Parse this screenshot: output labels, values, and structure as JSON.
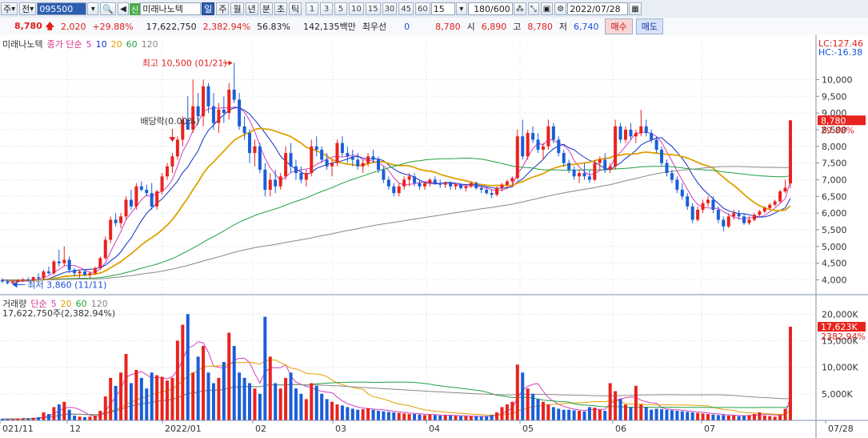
{
  "toolbar": {
    "market_label": "주",
    "prev_label": "전",
    "code": "095500",
    "badge": "신",
    "name": "미래나노텍",
    "periods": [
      "일",
      "주",
      "월",
      "년",
      "분",
      "초",
      "틱"
    ],
    "active_period": "일",
    "intervals": [
      "1",
      "3",
      "5",
      "10",
      "15",
      "30",
      "45",
      "60"
    ],
    "interval_value": "15",
    "count": "180/600",
    "date": "2022/07/28",
    "icons": [
      "search-icon",
      "zoom-icon",
      "save-icon",
      "gear-icon",
      "calendar-icon"
    ]
  },
  "quote": {
    "price": "8,780",
    "change": "2,020",
    "change_pct": "+29.88%",
    "volume": "17,622,750",
    "volume_pct": "2,382.94%",
    "rate": "56.83%",
    "amount": "142,135백만",
    "pref_label": "최우선",
    "pref_value": "0",
    "close": "8,780",
    "open_label": "시",
    "open": "6,890",
    "high_label": "고",
    "high": "8,780",
    "low_label": "저",
    "low": "6,740",
    "buy_label": "매수",
    "sell_label": "매도"
  },
  "chart_data": {
    "type": "candlestick",
    "title": "미래나노텍",
    "legend": "종가 단순 5 10 20 60 120",
    "legend_parts": [
      {
        "text": "미래나노텍",
        "color": "#333333"
      },
      {
        "text": "종가 단순",
        "color": "#d63384"
      },
      {
        "text": "5",
        "color": "#d040c0"
      },
      {
        "text": "10",
        "color": "#1030c0"
      },
      {
        "text": "20",
        "color": "#e0a000"
      },
      {
        "text": "60",
        "color": "#20a040"
      },
      {
        "text": "120",
        "color": "#888888"
      }
    ],
    "lc_label": "LC:127.46",
    "hc_label": "HC:-16.38",
    "y_ticks": [
      10000,
      9500,
      9000,
      8500,
      8000,
      7500,
      7000,
      6500,
      6000,
      5500,
      5000,
      4500,
      4000
    ],
    "y_tick_labels": [
      "10,000",
      "9,500",
      "9,000",
      "8,500",
      "8,000",
      "7,500",
      "7,000",
      "6,500",
      "6,000",
      "5,500",
      "5,000",
      "4,500",
      "4,000"
    ],
    "current_price_label": "8,780",
    "current_pct_label": "29.88%",
    "annotations": {
      "high": "최고 10,500 (01/21)",
      "low": "최저 3,860 (11/11)",
      "dividend": "배당락(0.00%)"
    },
    "x_labels": [
      "021/11",
      "12",
      "2022/01",
      "02",
      "03",
      "04",
      "05",
      "06",
      "07",
      "07/28"
    ],
    "candles": [
      [
        4000,
        4050,
        3900,
        3950
      ],
      [
        3950,
        4000,
        3860,
        3900
      ],
      [
        3900,
        3980,
        3870,
        3940
      ],
      [
        3940,
        4020,
        3900,
        3980
      ],
      [
        3980,
        4060,
        3940,
        4010
      ],
      [
        4010,
        4080,
        3960,
        3990
      ],
      [
        3990,
        4100,
        3950,
        4080
      ],
      [
        4080,
        4200,
        4000,
        4050
      ],
      [
        4050,
        4300,
        4000,
        4250
      ],
      [
        4250,
        4400,
        4150,
        4200
      ],
      [
        4200,
        4600,
        4150,
        4550
      ],
      [
        4550,
        4900,
        4400,
        4500
      ],
      [
        4500,
        5000,
        4400,
        4600
      ],
      [
        4600,
        4700,
        4200,
        4300
      ],
      [
        4300,
        4350,
        4100,
        4200
      ],
      [
        4200,
        4300,
        4050,
        4250
      ],
      [
        4250,
        4300,
        4100,
        4150
      ],
      [
        4150,
        4250,
        4050,
        4200
      ],
      [
        4200,
        4400,
        4150,
        4350
      ],
      [
        4350,
        4700,
        4300,
        4650
      ],
      [
        4650,
        5300,
        4600,
        5200
      ],
      [
        5200,
        5900,
        5100,
        5800
      ],
      [
        5800,
        6000,
        5600,
        5700
      ],
      [
        5700,
        6000,
        5550,
        5900
      ],
      [
        5900,
        6500,
        5800,
        6400
      ],
      [
        6400,
        6700,
        6100,
        6200
      ],
      [
        6200,
        6900,
        6100,
        6800
      ],
      [
        6800,
        6950,
        6650,
        6700
      ],
      [
        6700,
        6850,
        6500,
        6600
      ],
      [
        6600,
        6900,
        6100,
        6200
      ],
      [
        6200,
        6700,
        6100,
        6650
      ],
      [
        6650,
        7200,
        6550,
        7100
      ],
      [
        7100,
        7500,
        7000,
        7400
      ],
      [
        7400,
        7800,
        7200,
        7700
      ],
      [
        7700,
        8300,
        7600,
        8200
      ],
      [
        8200,
        8900,
        8000,
        8800
      ],
      [
        8800,
        9500,
        8600,
        8500
      ],
      [
        8500,
        10000,
        8400,
        9200
      ],
      [
        9200,
        9600,
        8700,
        8900
      ],
      [
        8900,
        10000,
        8600,
        9800
      ],
      [
        9800,
        9900,
        9000,
        9200
      ],
      [
        9200,
        9600,
        8500,
        8700
      ],
      [
        8700,
        9300,
        8400,
        9100
      ],
      [
        9100,
        9500,
        8700,
        9000
      ],
      [
        9000,
        9900,
        8800,
        9700
      ],
      [
        9700,
        10500,
        9300,
        9400
      ],
      [
        9400,
        9600,
        8500,
        8600
      ],
      [
        8600,
        8900,
        8200,
        8400
      ],
      [
        8400,
        8500,
        7500,
        7800
      ],
      [
        7800,
        8200,
        7400,
        8000
      ],
      [
        8000,
        8100,
        7200,
        7300
      ],
      [
        7300,
        7500,
        6500,
        6700
      ],
      [
        6700,
        7200,
        6500,
        7000
      ],
      [
        7000,
        7300,
        6600,
        6800
      ],
      [
        6800,
        7200,
        6700,
        7100
      ],
      [
        7100,
        8000,
        7000,
        7800
      ],
      [
        7800,
        8100,
        7200,
        7400
      ],
      [
        7400,
        7600,
        7000,
        7200
      ],
      [
        7200,
        7400,
        6900,
        7000
      ],
      [
        7000,
        7300,
        6800,
        7200
      ],
      [
        7200,
        8200,
        7100,
        8000
      ],
      [
        8000,
        8300,
        7700,
        7900
      ],
      [
        7900,
        8000,
        7500,
        7600
      ],
      [
        7600,
        7800,
        7300,
        7400
      ],
      [
        7400,
        7600,
        7100,
        7500
      ],
      [
        7500,
        8200,
        7400,
        8100
      ],
      [
        8100,
        8300,
        7700,
        7800
      ],
      [
        7800,
        8000,
        7500,
        7700
      ],
      [
        7700,
        7900,
        7400,
        7600
      ],
      [
        7600,
        7800,
        7300,
        7400
      ],
      [
        7400,
        7600,
        7200,
        7500
      ],
      [
        7500,
        7800,
        7400,
        7700
      ],
      [
        7700,
        7900,
        7500,
        7600
      ],
      [
        7600,
        7700,
        7200,
        7300
      ],
      [
        7300,
        7400,
        6900,
        7000
      ],
      [
        7000,
        7100,
        6700,
        6800
      ],
      [
        6800,
        6900,
        6500,
        6600
      ],
      [
        6600,
        6900,
        6500,
        6800
      ],
      [
        6800,
        7100,
        6700,
        7000
      ],
      [
        7000,
        7200,
        6800,
        7100
      ],
      [
        7100,
        7200,
        6800,
        6900
      ],
      [
        6900,
        7000,
        6700,
        6800
      ],
      [
        6800,
        6950,
        6700,
        6900
      ],
      [
        6900,
        7050,
        6800,
        7000
      ],
      [
        7000,
        7100,
        6850,
        6900
      ],
      [
        6900,
        7000,
        6750,
        6850
      ],
      [
        6850,
        6950,
        6750,
        6900
      ],
      [
        6900,
        6950,
        6700,
        6800
      ],
      [
        6800,
        6900,
        6700,
        6850
      ],
      [
        6850,
        6900,
        6700,
        6750
      ],
      [
        6750,
        6850,
        6650,
        6800
      ],
      [
        6800,
        6950,
        6750,
        6900
      ],
      [
        6900,
        6950,
        6700,
        6750
      ],
      [
        6750,
        6800,
        6600,
        6700
      ],
      [
        6700,
        6800,
        6550,
        6600
      ],
      [
        6600,
        6700,
        6450,
        6550
      ],
      [
        6550,
        6800,
        6500,
        6750
      ],
      [
        6750,
        6900,
        6650,
        6850
      ],
      [
        6850,
        7000,
        6750,
        6950
      ],
      [
        6950,
        7100,
        6800,
        7050
      ],
      [
        7050,
        8500,
        7000,
        8300
      ],
      [
        8300,
        8800,
        7600,
        7700
      ],
      [
        7700,
        8500,
        7600,
        8400
      ],
      [
        8400,
        8600,
        8100,
        8200
      ],
      [
        8200,
        8400,
        7800,
        7900
      ],
      [
        7900,
        8100,
        7600,
        8000
      ],
      [
        8000,
        8800,
        7900,
        8600
      ],
      [
        8600,
        8700,
        8100,
        8200
      ],
      [
        8200,
        8300,
        7700,
        7800
      ],
      [
        7800,
        7900,
        7400,
        7500
      ],
      [
        7500,
        7600,
        7200,
        7300
      ],
      [
        7300,
        7400,
        7000,
        7100
      ],
      [
        7100,
        7300,
        6900,
        7200
      ],
      [
        7200,
        7500,
        7000,
        7100
      ],
      [
        7100,
        7300,
        6900,
        7000
      ],
      [
        7000,
        7600,
        6950,
        7500
      ],
      [
        7500,
        7700,
        7300,
        7600
      ],
      [
        7600,
        7800,
        7200,
        7300
      ],
      [
        7300,
        7500,
        7200,
        7400
      ],
      [
        7400,
        8800,
        7300,
        8600
      ],
      [
        8600,
        8700,
        8100,
        8200
      ],
      [
        8200,
        8600,
        8100,
        8500
      ],
      [
        8500,
        8700,
        8200,
        8300
      ],
      [
        8300,
        8500,
        8100,
        8400
      ],
      [
        8400,
        9100,
        8300,
        8600
      ],
      [
        8600,
        8800,
        8300,
        8400
      ],
      [
        8400,
        8500,
        8100,
        8200
      ],
      [
        8200,
        8300,
        7800,
        7900
      ],
      [
        7900,
        8000,
        7400,
        7500
      ],
      [
        7500,
        7600,
        7100,
        7200
      ],
      [
        7200,
        7300,
        6900,
        7000
      ],
      [
        7000,
        7100,
        6600,
        6700
      ],
      [
        6700,
        6900,
        6400,
        6500
      ],
      [
        6500,
        6600,
        6100,
        6200
      ],
      [
        6200,
        6300,
        5700,
        5800
      ],
      [
        5800,
        6200,
        5750,
        6100
      ],
      [
        6100,
        6400,
        6000,
        6300
      ],
      [
        6300,
        6500,
        6200,
        6400
      ],
      [
        6400,
        6500,
        6000,
        6100
      ],
      [
        6100,
        6200,
        5700,
        5800
      ],
      [
        5800,
        5900,
        5450,
        5600
      ],
      [
        5600,
        6000,
        5550,
        5900
      ],
      [
        5900,
        6100,
        5800,
        6000
      ],
      [
        6000,
        6100,
        5800,
        5900
      ],
      [
        5900,
        6000,
        5650,
        5700
      ],
      [
        5700,
        5900,
        5650,
        5800
      ],
      [
        5800,
        6000,
        5750,
        5950
      ],
      [
        5950,
        6100,
        5900,
        6050
      ],
      [
        6050,
        6200,
        6000,
        6150
      ],
      [
        6150,
        6300,
        6100,
        6250
      ],
      [
        6250,
        6400,
        6200,
        6350
      ],
      [
        6350,
        6700,
        6300,
        6650
      ],
      [
        6650,
        7000,
        6600,
        6760
      ],
      [
        6890,
        8780,
        6740,
        8780
      ]
    ],
    "ma": [
      {
        "period": 5,
        "color": "#d040c0",
        "width": 1
      },
      {
        "period": 10,
        "color": "#1030c0",
        "width": 1
      },
      {
        "period": 20,
        "color": "#e0a000",
        "width": 1.8
      },
      {
        "period": 60,
        "color": "#20a040",
        "width": 1
      },
      {
        "period": 120,
        "color": "#888888",
        "width": 1
      }
    ],
    "prior_close": 4000,
    "volume_legend": "거래량 단순 5 20 60 120",
    "volume_legend_parts": [
      {
        "text": "거래량",
        "color": "#333333"
      },
      {
        "text": "단순",
        "color": "#d63384"
      },
      {
        "text": "5",
        "color": "#d040c0"
      },
      {
        "text": "20",
        "color": "#e0a000"
      },
      {
        "text": "60",
        "color": "#20a040"
      },
      {
        "text": "120",
        "color": "#888888"
      }
    ],
    "volume_current_label": "17,622,750주(2,382.94%)",
    "volume_y_ticks": [
      20000,
      15000,
      10000,
      5000
    ],
    "volume_y_tick_labels": [
      "20,000K",
      "15,000K",
      "10,000K",
      "5,000K"
    ],
    "volume_value_label": "17,623K",
    "volume_pct_label": "2382.94%",
    "volume_ylim": [
      0,
      22000
    ],
    "volumes": [
      300,
      250,
      280,
      320,
      400,
      350,
      500,
      600,
      1500,
      1200,
      2500,
      3000,
      3500,
      2000,
      900,
      700,
      600,
      700,
      900,
      1800,
      4500,
      8000,
      6500,
      9000,
      12500,
      7000,
      9500,
      8000,
      6000,
      9000,
      8500,
      8200,
      7500,
      8000,
      15000,
      18000,
      20000,
      9000,
      12000,
      14000,
      9000,
      7000,
      8000,
      11000,
      16500,
      14000,
      9000,
      8000,
      7000,
      6000,
      5000,
      19500,
      12000,
      7000,
      6000,
      8000,
      9000,
      6000,
      5000,
      4000,
      7000,
      6500,
      5000,
      4000,
      3500,
      3000,
      2800,
      2500,
      2200,
      2000,
      2100,
      2300,
      2000,
      1800,
      1700,
      1600,
      1500,
      1400,
      1300,
      1200,
      1200,
      1100,
      1000,
      1100,
      1000,
      900,
      950,
      900,
      850,
      800,
      780,
      760,
      740,
      720,
      800,
      1000,
      1500,
      2500,
      3000,
      3500,
      10500,
      9000,
      6000,
      5000,
      4000,
      3500,
      3000,
      2500,
      2200,
      2000,
      2000,
      1900,
      1800,
      1700,
      2500,
      2400,
      2000,
      1800,
      7000,
      5500,
      4000,
      3000,
      2500,
      6500,
      3000,
      2500,
      2000,
      2200,
      2100,
      2000,
      1900,
      1800,
      1700,
      1600,
      1500,
      1400,
      1300,
      1200,
      1100,
      1000,
      1000,
      900,
      900,
      800,
      850,
      1000,
      1200,
      1500,
      900,
      800,
      700,
      1000,
      2200,
      17623
    ]
  }
}
